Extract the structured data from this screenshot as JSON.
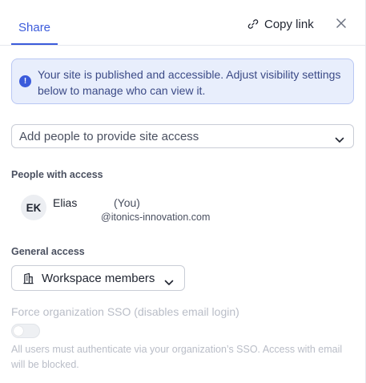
{
  "header": {
    "tab_share": "Share",
    "copy_link": "Copy link",
    "icons": {
      "copy": "link-icon",
      "close": "close-icon"
    }
  },
  "banner": {
    "text": "Your site is published and accessible. Adjust visibility settings below to manage who can view it.",
    "icon": "info-icon",
    "colors": {
      "background": "#e8eefc",
      "border": "#b9c7f3",
      "accent": "#3b5bdb"
    }
  },
  "add_people": {
    "placeholder": "Add people to provide site access",
    "icon": "chevron-down-icon"
  },
  "people": {
    "title": "People with access",
    "list": [
      {
        "initials": "EK",
        "name": "Elias",
        "you": "(You)",
        "email": "@itonics-innovation.com"
      }
    ]
  },
  "general_access": {
    "title": "General access",
    "selected": "Workspace members",
    "icon": "building-icon"
  },
  "sso": {
    "title": "Force organization SSO (disables email login)",
    "enabled": false,
    "description": "All users must authenticate via your organization’s SSO. Access with email will be blocked."
  },
  "colors": {
    "accent": "#3b5bdb",
    "text": "#1f2430",
    "muted": "#4a5060",
    "disabled": "#b9bdc7"
  }
}
